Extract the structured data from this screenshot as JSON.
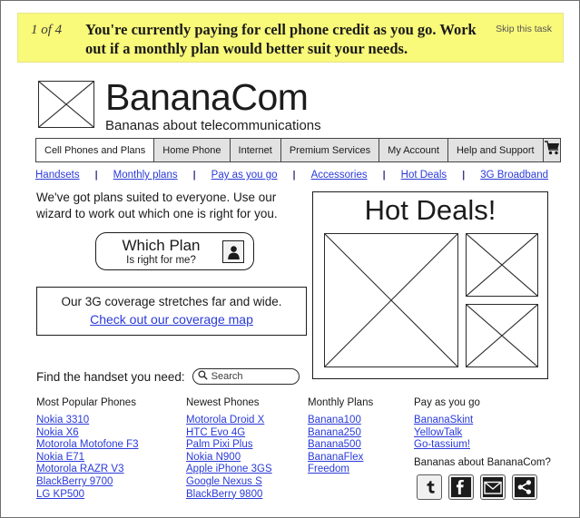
{
  "task_banner": {
    "counter": "1 of 4",
    "message": "You're currently paying for cell phone credit as you go. Work out if a monthly plan would better suit your needs.",
    "skip_label": "Skip this task",
    "background_color": "#f9f97a"
  },
  "brand": {
    "name": "BananaCom",
    "tagline": "Bananas about telecommunications",
    "logo_icon": "crossed-box-placeholder-icon"
  },
  "main_nav": {
    "tabs": [
      {
        "label": "Cell Phones and Plans",
        "active": true
      },
      {
        "label": "Home Phone",
        "active": false
      },
      {
        "label": "Internet",
        "active": false
      },
      {
        "label": "Premium Services",
        "active": false
      },
      {
        "label": "My Account",
        "active": false
      },
      {
        "label": "Help and Support",
        "active": false
      }
    ],
    "cart_icon": "shopping-cart-icon"
  },
  "sub_nav": {
    "separator": "|",
    "links": [
      "Handsets",
      "Monthly plans",
      "Pay as you go",
      "Accessories",
      "Hot Deals",
      "3G Broadband"
    ]
  },
  "promo": {
    "intro": "We've got plans suited to everyone. Use our wizard to work out which one is right for you.",
    "which_plan_title": "Which Plan",
    "which_plan_sub": "Is right for me?",
    "which_plan_icon": "person-avatar-icon",
    "coverage_text": "Our 3G coverage stretches far and wide.",
    "coverage_link": "Check out our coverage map"
  },
  "hot_deals": {
    "title": "Hot Deals!",
    "image_placeholders": [
      "hot-deal-large-placeholder",
      "hot-deal-small-placeholder-1",
      "hot-deal-small-placeholder-2"
    ]
  },
  "search": {
    "label": "Find the handset you need:",
    "placeholder": "Search",
    "value": "",
    "icon": "magnifying-glass-icon"
  },
  "footer": {
    "columns": [
      {
        "heading": "Most Popular Phones",
        "links": [
          "Nokia 3310",
          "Nokia X6",
          "Motorola Motofone F3",
          "Nokia E71",
          "Motorola RAZR V3",
          "BlackBerry 9700",
          "LG KP500"
        ]
      },
      {
        "heading": "Newest Phones",
        "links": [
          "Motorola Droid X",
          "HTC Evo 4G",
          "Palm Pixi Plus",
          "Nokia N900",
          "Apple iPhone 3GS",
          "Google Nexus S",
          "BlackBerry 9800"
        ]
      },
      {
        "heading": "Monthly Plans",
        "links": [
          "Banana100",
          "Banana250",
          "Banana500",
          "BananaFlex",
          "Freedom"
        ]
      },
      {
        "heading": "Pay as you go",
        "links": [
          "BananaSkint",
          "YellowTalk",
          "Go-tassium!"
        ]
      }
    ],
    "social_question": "Bananas about BananaCom?",
    "social_buttons": [
      "twitter-icon",
      "facebook-icon",
      "email-icon",
      "share-icon"
    ]
  },
  "colors": {
    "link": "#2a3ad8",
    "banner": "#f9f97a",
    "text": "#1a1a1a"
  }
}
